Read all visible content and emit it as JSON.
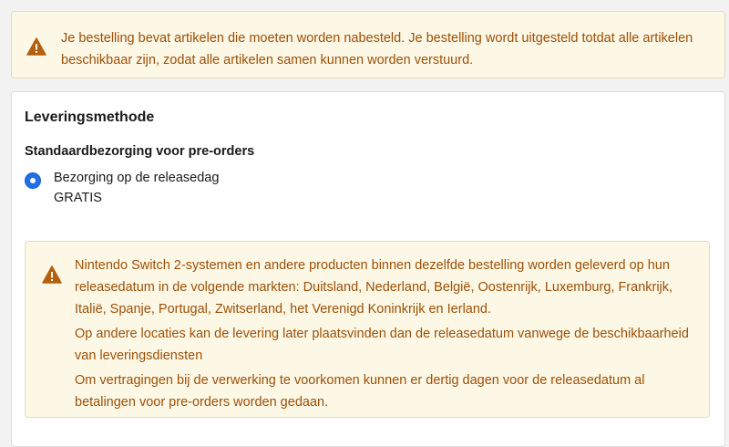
{
  "top_notice": {
    "text": "Je bestelling bevat artikelen die moeten worden nabesteld. Je bestelling wordt uitgesteld totdat alle artikelen beschikbaar zijn, zodat alle artikelen samen kunnen worden verstuurd."
  },
  "delivery": {
    "title": "Leveringsmethode",
    "group_title": "Standaardbezorging voor pre-orders",
    "option": {
      "label": "Bezorging op de releasedag",
      "price": "GRATIS",
      "selected": true
    },
    "notice": {
      "paragraphs": [
        "Nintendo Switch 2-systemen en andere producten binnen dezelfde bestelling worden geleverd op hun releasedatum in de volgende markten: Duitsland, Nederland, België, Oostenrijk, Luxemburg, Frankrijk, Italië, Spanje, Portugal, Zwitserland, het Verenigd Koninkrijk en Ierland.",
        "Op andere locaties kan de levering later plaatsvinden dan de releasedatum vanwege de beschikbaarheid van leveringsdiensten",
        "Om vertragingen bij de verwerking te voorkomen kunnen er dertig dagen voor de releasedatum al betalingen voor pre-orders worden gedaan."
      ]
    }
  },
  "colors": {
    "notice_bg": "#fdf8e5",
    "notice_text": "#9c4f08",
    "warning_icon": "#b5600f",
    "radio_selected": "#1e6fe8"
  },
  "icons": {
    "warning": "warning-icon"
  }
}
